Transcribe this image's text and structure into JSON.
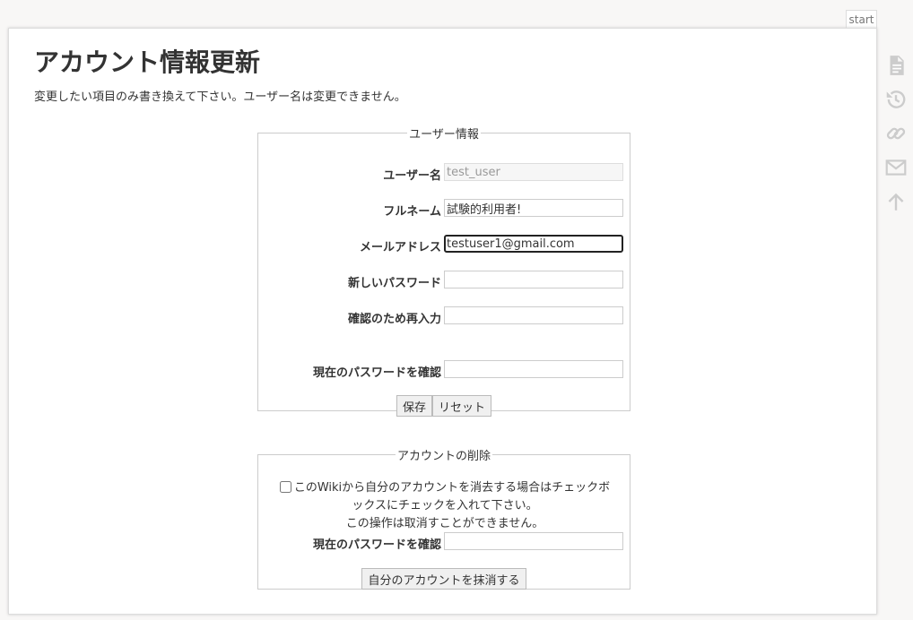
{
  "page_tab": "start",
  "title": "アカウント情報更新",
  "intro": "変更したい項目のみ書き換えて下さい。ユーザー名は変更できません。",
  "user_info": {
    "legend": "ユーザー情報",
    "username_label": "ユーザー名",
    "username_value": "test_user",
    "fullname_label": "フルネーム",
    "fullname_value": "試験的利用者!",
    "email_label": "メールアドレス",
    "email_value": "testuser1@gmail.com",
    "new_password_label": "新しいパスワード",
    "new_password_value": "",
    "confirm_password_label": "確認のため再入力",
    "confirm_password_value": "",
    "current_password_label": "現在のパスワードを確認",
    "current_password_value": "",
    "save_label": "保存",
    "reset_label": "リセット"
  },
  "delete_account": {
    "legend": "アカウントの削除",
    "checkbox_text_1": "このWikiから自分のアカウントを消去する場合はチェックボ",
    "checkbox_text_2": "ックスにチェックを入れて下さい。",
    "warning": "この操作は取消すことができません。",
    "checkbox_checked": false,
    "current_password_label": "現在のパスワードを確認",
    "current_password_value": "",
    "delete_label": "自分のアカウントを抹消する"
  },
  "side_tools": [
    "document-icon",
    "history-icon",
    "link-icon",
    "mail-icon",
    "arrow-up-icon"
  ],
  "colors": {
    "icon": "#cccccc",
    "border": "#cccccc",
    "text": "#333333"
  }
}
